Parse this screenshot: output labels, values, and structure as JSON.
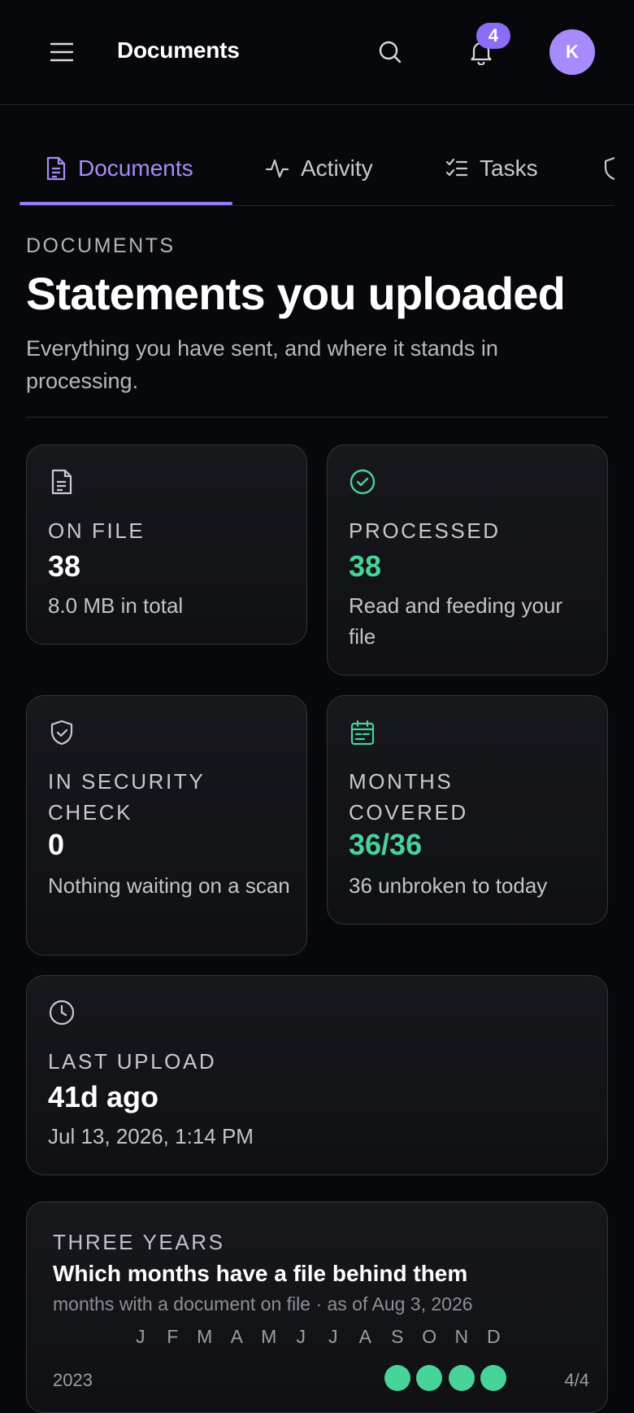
{
  "header": {
    "title": "Documents",
    "notification_count": "4",
    "avatar_initial": "K",
    "icons": {
      "menu": "hamburger-icon",
      "search": "search-icon",
      "notifications": "bell-icon"
    }
  },
  "tabs": [
    {
      "label": "Documents",
      "icon": "document-icon",
      "active": true
    },
    {
      "label": "Activity",
      "icon": "activity-pulse-icon",
      "active": false
    },
    {
      "label": "Tasks",
      "icon": "checklist-icon",
      "active": false
    },
    {
      "label": "",
      "icon": "shield-icon",
      "active": false
    }
  ],
  "page": {
    "eyebrow": "DOCUMENTS",
    "title": "Statements you uploaded",
    "subtitle": "Everything you have sent, and where it stands in processing."
  },
  "stats": {
    "on_file": {
      "label": "ON FILE",
      "value": "38",
      "note": "8.0 MB in total",
      "icon": "document-icon"
    },
    "processed": {
      "label": "PROCESSED",
      "value": "38",
      "note": "Read and feeding your file",
      "icon": "check-circle-icon"
    },
    "security": {
      "label": "IN SECURITY CHECK",
      "value": "0",
      "note": "Nothing waiting on a scan",
      "icon": "shield-check-icon"
    },
    "months": {
      "label": "MONTHS COVERED",
      "value": "36/36",
      "note": "36 unbroken to today",
      "icon": "calendar-icon"
    },
    "last_upload": {
      "label": "LAST UPLOAD",
      "value": "41d ago",
      "note": "Jul 13, 2026, 1:14 PM",
      "icon": "clock-icon"
    }
  },
  "coverage": {
    "eyebrow": "THREE YEARS",
    "title": "Which months have a file behind them",
    "subtitle": "months with a document on file · as of Aug 3, 2026",
    "months": [
      "J",
      "F",
      "M",
      "A",
      "M",
      "J",
      "J",
      "A",
      "S",
      "O",
      "N",
      "D"
    ],
    "years": [
      {
        "label": "2023",
        "covered": [
          false,
          false,
          false,
          false,
          false,
          false,
          false,
          false,
          true,
          true,
          true,
          true
        ],
        "count": "4/4"
      }
    ]
  },
  "colors": {
    "accent": "#9a7af5",
    "success": "#48d39a",
    "background": "#07080c",
    "card_border": "#34353c"
  }
}
